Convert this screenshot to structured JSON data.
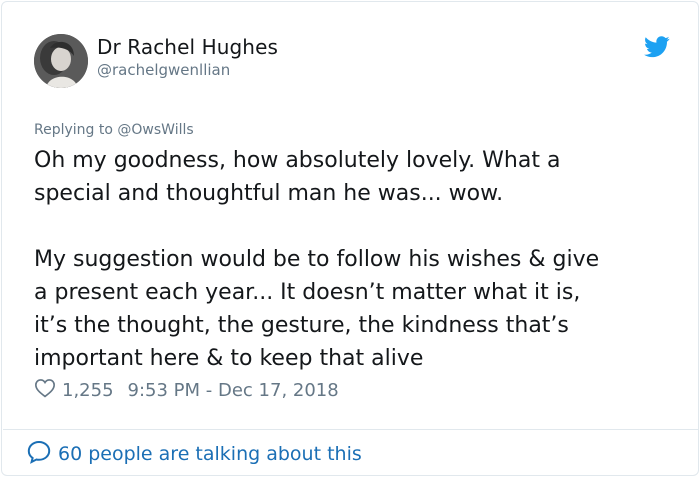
{
  "author": {
    "display_name": "Dr Rachel Hughes",
    "handle": "@rachelgwenllian"
  },
  "reply": {
    "prefix": "Replying to ",
    "mention": "@OwsWills"
  },
  "tweet": {
    "text": "Oh my goodness, how absolutely lovely. What a\nspecial and thoughtful man he was... wow.\n\nMy suggestion would be to follow his wishes & give\na present each year... It doesn’t matter what it is,\nit’s the thought, the gesture, the kindness that’s\nimportant here & to keep that alive"
  },
  "meta": {
    "likes": "1,255",
    "timestamp": "9:53 PM - Dec 17, 2018"
  },
  "footer": {
    "talking": "60 people are talking about this"
  },
  "colors": {
    "twitter_blue": "#1da1f2",
    "link_blue": "#1b6fb5",
    "muted": "#657786"
  },
  "icons": {
    "brand": "twitter-bird-icon",
    "like": "heart-outline-icon",
    "conversation": "speech-bubble-icon"
  }
}
